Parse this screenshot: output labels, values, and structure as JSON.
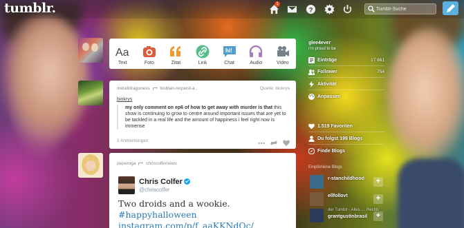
{
  "header": {
    "logo": "tumblr.",
    "notification_count": "1",
    "search_placeholder": "Tumblr-Suche",
    "icons": [
      "home-icon",
      "mail-icon",
      "help-icon",
      "settings-icon",
      "power-icon",
      "compose-icon"
    ]
  },
  "compose": {
    "types": [
      {
        "label": "Text",
        "icon": "text-icon",
        "color": "#444444"
      },
      {
        "label": "Foto",
        "icon": "camera-icon",
        "color": "#d95e40"
      },
      {
        "label": "Zitat",
        "icon": "quote-icon",
        "color": "#f2992e"
      },
      {
        "label": "Link",
        "icon": "link-icon",
        "color": "#56bc8a"
      },
      {
        "label": "Chat",
        "icon": "chat-icon",
        "color": "#529ecc"
      },
      {
        "label": "Audio",
        "icon": "headphones-icon",
        "color": "#a77dc2"
      },
      {
        "label": "Video",
        "icon": "video-icon",
        "color": "#748089"
      }
    ]
  },
  "post1": {
    "author": "metalldragoness",
    "reblogged_from": "losblan-request-a..",
    "source": "Quelle: biokrys",
    "link_text": "biokrys",
    "quote_bold": "my only comment on ep6 of how to get away with murder is that",
    "quote_rest": " this show is continuing to grow to centre around important issues that are yet to be tackled in a real life and the amount of happiness i feel right now is immense",
    "notes": "3 Anmerkungen"
  },
  "post2": {
    "author": "peperoga",
    "reblogged_from": "chriscolfernews",
    "tweet_name": "Chris Colfer",
    "tweet_handle": "@chriscolfer",
    "tweet_text": "Two droids and a wookie. ",
    "tweet_hashtag": "#happyhalloween",
    "tweet_link": "instagram.com/p/f_aaKKNdQc/"
  },
  "sidebar": {
    "blog_name": "glee4ever",
    "blog_desc": "I'm proud to be",
    "items": [
      {
        "label": "Einträge",
        "count": "17 861",
        "icon": "posts-icon"
      },
      {
        "label": "Follower",
        "count": "754",
        "icon": "followers-icon"
      },
      {
        "label": "Aktivität",
        "count": "",
        "icon": "activity-icon"
      },
      {
        "label": "Anpassen",
        "count": "",
        "icon": "customize-icon"
      }
    ],
    "links": [
      {
        "label": "1.519 Favoriten",
        "icon": "heart-icon"
      },
      {
        "label": "Du folgst 199 Blogs",
        "icon": "following-icon"
      },
      {
        "label": "Finde Blogs",
        "icon": "compass-icon"
      }
    ],
    "recommended_title": "Empfohlene Blogs",
    "recommended": [
      {
        "name": "r-stanchildhood",
        "sub": "",
        "color": "#3b6b8a"
      },
      {
        "name": "ellfollovt",
        "sub": "",
        "color": "#7a5a3a"
      },
      {
        "name": "grantgustinbrasil",
        "sub": "der Tumblr - Alles … Rechtl.",
        "color": "#2a3a5a"
      }
    ]
  }
}
